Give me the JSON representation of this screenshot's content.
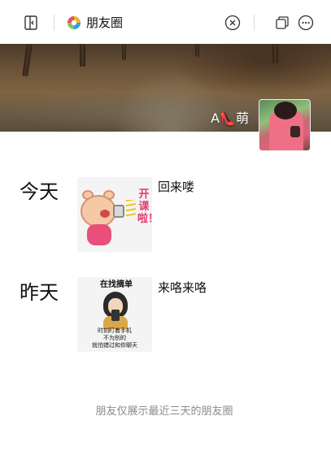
{
  "window": {
    "title": "朋友圈",
    "icons": {
      "sidebar_toggle": "sidebar-toggle-icon",
      "app": "moments-app-icon",
      "close": "close-circle-icon",
      "restore": "restore-window-icon",
      "more": "more-options-icon"
    }
  },
  "profile": {
    "username": "A👠萌",
    "cover_image": "forest-path-photo",
    "avatar_image": "woman-in-pink-coat-photo"
  },
  "timeline": [
    {
      "day": "今天",
      "caption": "回来喽",
      "image": {
        "kind": "sticker",
        "text": "开课啦！"
      }
    },
    {
      "day": "昨天",
      "caption": "来咯来咯",
      "image": {
        "kind": "sticker",
        "title": "在找摘单",
        "lines": [
          "时刻盯着手机",
          "不为别的",
          "就怕错过和你聊天"
        ]
      }
    }
  ],
  "footer": {
    "notice": "朋友仅展示最近三天的朋友圈"
  },
  "colors": {
    "background": "#ffffff",
    "text": "#111111",
    "footer_text": "#8a8a8a"
  }
}
